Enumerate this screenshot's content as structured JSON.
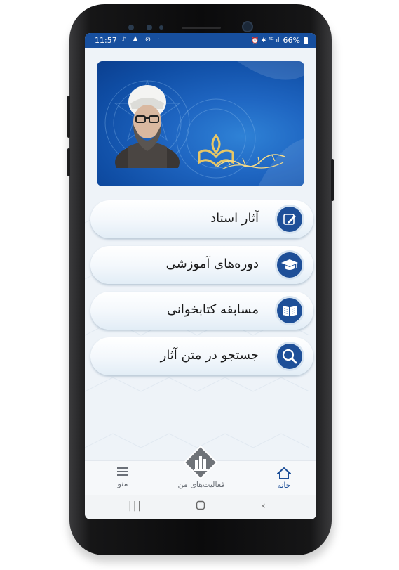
{
  "status_bar": {
    "time": "11:57",
    "notification_icons": "♪ ♟ ⊘ ·",
    "system_icons": "⏰ ✱ ⁴ᴳ ıl",
    "battery_percent": "66%"
  },
  "banner": {
    "logo_name": "book-logo",
    "calligraphy": "بنیاد علمی فرهنگی استاد شهید مطهری"
  },
  "menu": {
    "items": [
      {
        "label": "آثار استاد",
        "icon": "pencil-edit-icon"
      },
      {
        "label": "دوره‌های آموزشی",
        "icon": "graduation-cap-icon"
      },
      {
        "label": "مسابقه کتابخوانی",
        "icon": "open-book-icon"
      },
      {
        "label": "جستجو در متن آثار",
        "icon": "search-icon"
      }
    ]
  },
  "bottom_nav": {
    "home": "خانه",
    "activities": "فعالیت‌های من",
    "menu": "منو"
  },
  "colors": {
    "accent": "#1e4f98",
    "status_bar": "#174f9e"
  }
}
